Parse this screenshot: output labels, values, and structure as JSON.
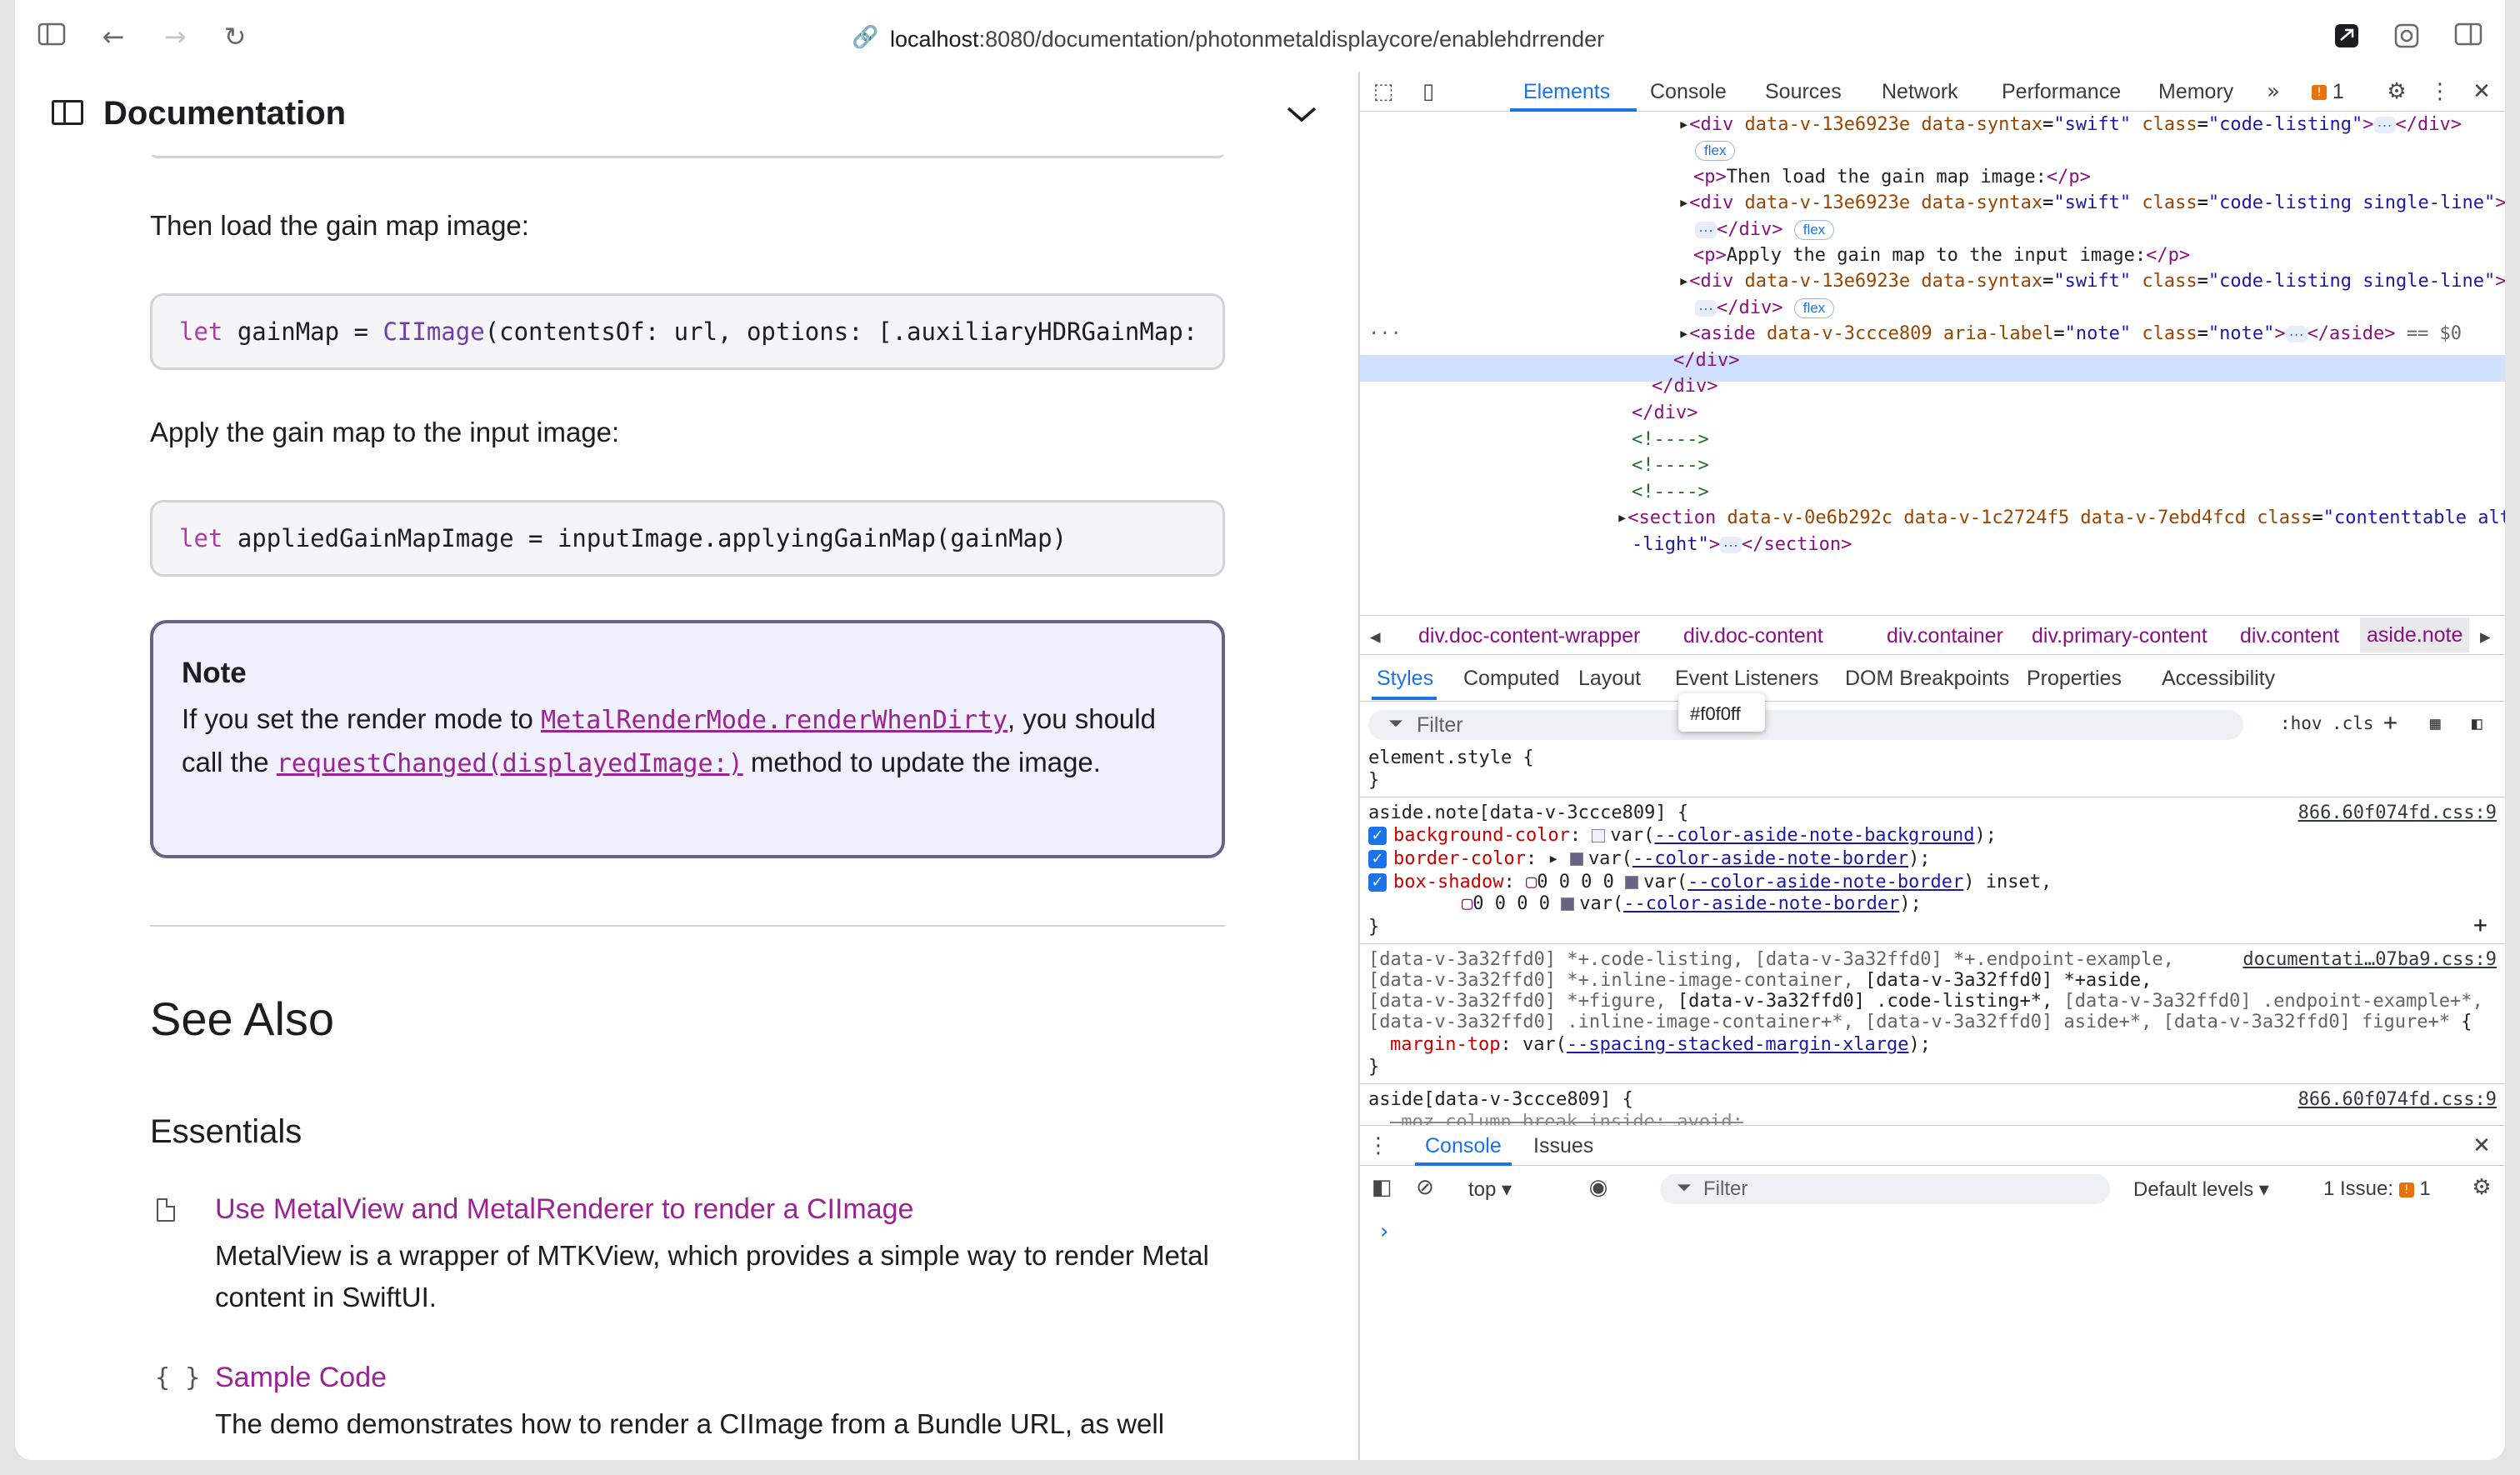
{
  "browser": {
    "url_host": "localhost",
    "url_rest": ":8080/documentation/photonmetaldisplaycore/enablehdrrender"
  },
  "doc": {
    "header_title": "Documentation",
    "para1": "Then load the gain map image:",
    "code1_kw": "let",
    "code1_a": " gainMap = ",
    "code1_type": "CIImage",
    "code1_b": "(contentsOf: url, options: [.auxiliaryHDRGainMap:",
    "para2": "Apply the gain map to the input image:",
    "code2_kw": "let",
    "code2_a": " appliedGainMapImage = inputImage.applyingGainMap(gainMap)",
    "note_title": "Note",
    "note_text1": "If you set the render mode to ",
    "note_link1": "MetalRenderMode.renderWhenDirty",
    "note_text2": ", you should call the ",
    "note_link2": "requestChanged(displayedImage:)",
    "note_text3": " method to update the image.",
    "see_also": "See Also",
    "essentials": "Essentials",
    "item1_link": "Use MetalView and MetalRenderer to render a CIImage",
    "item1_desc": "MetalView is a wrapper of MTKView, which provides a simple way to render Metal content in SwiftUI.",
    "item2_icon": "{ }",
    "item2_link": "Sample Code",
    "item2_desc": "The demo demonstrates how to render a CIImage from a Bundle URL, as well"
  },
  "devtools": {
    "tabs": [
      "Elements",
      "Console",
      "Sources",
      "Network",
      "Performance",
      "Memory"
    ],
    "issues_count": "1",
    "dom_lines": [
      {
        "t": "code-listing",
        "indent": 1040
      },
      {
        "t": "flex-only",
        "indent": 1048
      }
    ],
    "breadcrumbs": [
      "div.doc-content-wrapper",
      "div.doc-content",
      "div.container",
      "div.primary-content",
      "div.content",
      "aside.note"
    ],
    "subtabs": [
      "Styles",
      "Computed",
      "Layout",
      "Event Listeners",
      "DOM Breakpoints",
      "Properties",
      "Accessibility"
    ],
    "filter_placeholder": "Filter",
    "hov": ":hov",
    "cls": ".cls",
    "tooltip": "#f0f0ff",
    "src1": "866.60f074fd.css:9",
    "src2": "documentati…07ba9.css:9",
    "src3": "866.60f074fd.css:9",
    "drawer_tabs": [
      "Console",
      "Issues"
    ],
    "context": "top",
    "console_filter": "Filter",
    "default_levels": "Default levels",
    "issues_label": "1 Issue:",
    "issues_num": "1"
  }
}
